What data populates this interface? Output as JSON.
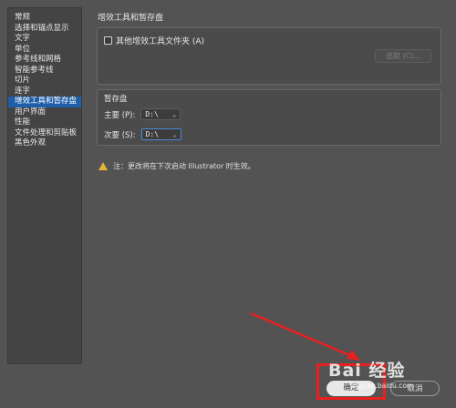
{
  "sidebar": {
    "items": [
      {
        "label": "常规"
      },
      {
        "label": "选择和锚点显示"
      },
      {
        "label": "文字"
      },
      {
        "label": "单位"
      },
      {
        "label": "参考线和网格"
      },
      {
        "label": "智能参考线"
      },
      {
        "label": "切片"
      },
      {
        "label": "连字"
      },
      {
        "label": "增效工具和暂存盘"
      },
      {
        "label": "用户界面"
      },
      {
        "label": "性能"
      },
      {
        "label": "文件处理和剪贴板"
      },
      {
        "label": "黑色外观"
      }
    ],
    "active_index": 8
  },
  "section": {
    "title": "增效工具和暂存盘"
  },
  "plugins": {
    "checkbox_label": "其他增效工具文件夹 (A)",
    "checked": false,
    "choose_label": "选取 (C)..."
  },
  "scratch": {
    "title": "暂存盘",
    "primary_label": "主要 (P):",
    "primary_value": "D:\\",
    "secondary_label": "次要 (S):",
    "secondary_value": "D:\\"
  },
  "note": {
    "text": "注：更改将在下次启动 Illustrator 时生效。"
  },
  "buttons": {
    "ok": "确定",
    "cancel": "取消"
  },
  "watermark": {
    "text": "Bai 经验",
    "sub": "jingyan.baidu.com"
  },
  "colors": {
    "active": "#1f5fa8",
    "annotation": "#e82020",
    "warning": "#e3b436"
  }
}
